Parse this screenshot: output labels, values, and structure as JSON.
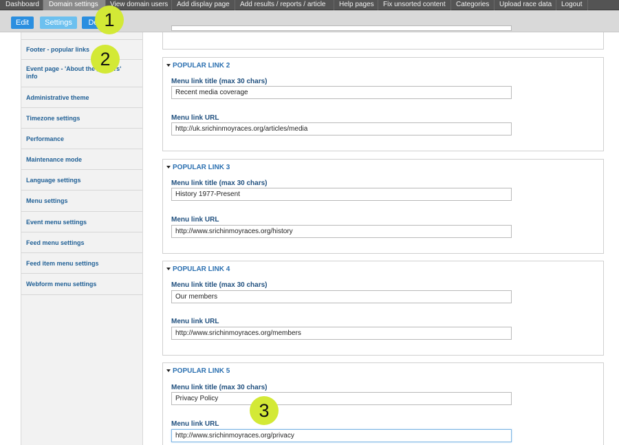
{
  "top_menu": {
    "items": [
      {
        "label": "Dashboard",
        "active": false
      },
      {
        "label": "Domain settings",
        "active": true
      },
      {
        "label": "View domain users",
        "active": false
      },
      {
        "label": "Add display page",
        "active": false
      },
      {
        "label": "Add results / reports / article",
        "active": false
      },
      {
        "label": "Help pages",
        "active": false
      },
      {
        "label": "Fix unsorted content",
        "active": false
      },
      {
        "label": "Categories",
        "active": false
      },
      {
        "label": "Upload race data",
        "active": false
      },
      {
        "label": "Logout",
        "active": false
      }
    ]
  },
  "toolbar": {
    "edit_label": "Edit",
    "settings_label": "Settings",
    "dev_label": "De"
  },
  "callouts": [
    "1",
    "2",
    "3"
  ],
  "sidebar": {
    "items": [
      {
        "label": "Footer - popular links"
      },
      {
        "label": "Event page - 'About the ___sers' info"
      },
      {
        "label": "Administrative theme"
      },
      {
        "label": "Timezone settings"
      },
      {
        "label": "Performance"
      },
      {
        "label": "Maintenance mode"
      },
      {
        "label": "Language settings"
      },
      {
        "label": "Menu settings"
      },
      {
        "label": "Event menu settings"
      },
      {
        "label": "Feed menu settings"
      },
      {
        "label": "Feed item menu settings"
      },
      {
        "label": "Webform menu settings"
      }
    ]
  },
  "main": {
    "fieldsets": [
      {
        "legend": "POPULAR LINK 2",
        "title_label": "Menu link title (max 30 chars)",
        "title_value": "Recent media coverage",
        "url_label": "Menu link URL",
        "url_value": "http://uk.srichinmoyraces.org/articles/media"
      },
      {
        "legend": "POPULAR LINK 3",
        "title_label": "Menu link title (max 30 chars)",
        "title_value": "History 1977-Present",
        "url_label": "Menu link URL",
        "url_value": "http://www.srichinmoyraces.org/history"
      },
      {
        "legend": "POPULAR LINK 4",
        "title_label": "Menu link title (max 30 chars)",
        "title_value": "Our members",
        "url_label": "Menu link URL",
        "url_value": "http://www.srichinmoyraces.org/members"
      },
      {
        "legend": "POPULAR LINK 5",
        "title_label": "Menu link title (max 30 chars)",
        "title_value": "Privacy Policy",
        "url_label": "Menu link URL",
        "url_value": "http://www.srichinmoyraces.org/privacy"
      }
    ]
  }
}
